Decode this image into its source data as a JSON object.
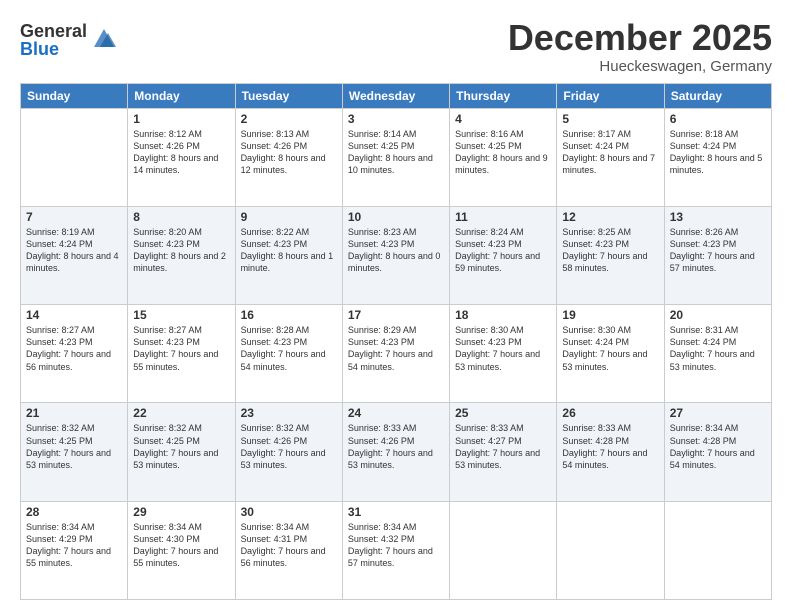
{
  "logo": {
    "general": "General",
    "blue": "Blue"
  },
  "title": "December 2025",
  "location": "Hueckeswagen, Germany",
  "days_of_week": [
    "Sunday",
    "Monday",
    "Tuesday",
    "Wednesday",
    "Thursday",
    "Friday",
    "Saturday"
  ],
  "weeks": [
    [
      {
        "num": "",
        "sunrise": "",
        "sunset": "",
        "daylight": ""
      },
      {
        "num": "1",
        "sunrise": "Sunrise: 8:12 AM",
        "sunset": "Sunset: 4:26 PM",
        "daylight": "Daylight: 8 hours and 14 minutes."
      },
      {
        "num": "2",
        "sunrise": "Sunrise: 8:13 AM",
        "sunset": "Sunset: 4:26 PM",
        "daylight": "Daylight: 8 hours and 12 minutes."
      },
      {
        "num": "3",
        "sunrise": "Sunrise: 8:14 AM",
        "sunset": "Sunset: 4:25 PM",
        "daylight": "Daylight: 8 hours and 10 minutes."
      },
      {
        "num": "4",
        "sunrise": "Sunrise: 8:16 AM",
        "sunset": "Sunset: 4:25 PM",
        "daylight": "Daylight: 8 hours and 9 minutes."
      },
      {
        "num": "5",
        "sunrise": "Sunrise: 8:17 AM",
        "sunset": "Sunset: 4:24 PM",
        "daylight": "Daylight: 8 hours and 7 minutes."
      },
      {
        "num": "6",
        "sunrise": "Sunrise: 8:18 AM",
        "sunset": "Sunset: 4:24 PM",
        "daylight": "Daylight: 8 hours and 5 minutes."
      }
    ],
    [
      {
        "num": "7",
        "sunrise": "Sunrise: 8:19 AM",
        "sunset": "Sunset: 4:24 PM",
        "daylight": "Daylight: 8 hours and 4 minutes."
      },
      {
        "num": "8",
        "sunrise": "Sunrise: 8:20 AM",
        "sunset": "Sunset: 4:23 PM",
        "daylight": "Daylight: 8 hours and 2 minutes."
      },
      {
        "num": "9",
        "sunrise": "Sunrise: 8:22 AM",
        "sunset": "Sunset: 4:23 PM",
        "daylight": "Daylight: 8 hours and 1 minute."
      },
      {
        "num": "10",
        "sunrise": "Sunrise: 8:23 AM",
        "sunset": "Sunset: 4:23 PM",
        "daylight": "Daylight: 8 hours and 0 minutes."
      },
      {
        "num": "11",
        "sunrise": "Sunrise: 8:24 AM",
        "sunset": "Sunset: 4:23 PM",
        "daylight": "Daylight: 7 hours and 59 minutes."
      },
      {
        "num": "12",
        "sunrise": "Sunrise: 8:25 AM",
        "sunset": "Sunset: 4:23 PM",
        "daylight": "Daylight: 7 hours and 58 minutes."
      },
      {
        "num": "13",
        "sunrise": "Sunrise: 8:26 AM",
        "sunset": "Sunset: 4:23 PM",
        "daylight": "Daylight: 7 hours and 57 minutes."
      }
    ],
    [
      {
        "num": "14",
        "sunrise": "Sunrise: 8:27 AM",
        "sunset": "Sunset: 4:23 PM",
        "daylight": "Daylight: 7 hours and 56 minutes."
      },
      {
        "num": "15",
        "sunrise": "Sunrise: 8:27 AM",
        "sunset": "Sunset: 4:23 PM",
        "daylight": "Daylight: 7 hours and 55 minutes."
      },
      {
        "num": "16",
        "sunrise": "Sunrise: 8:28 AM",
        "sunset": "Sunset: 4:23 PM",
        "daylight": "Daylight: 7 hours and 54 minutes."
      },
      {
        "num": "17",
        "sunrise": "Sunrise: 8:29 AM",
        "sunset": "Sunset: 4:23 PM",
        "daylight": "Daylight: 7 hours and 54 minutes."
      },
      {
        "num": "18",
        "sunrise": "Sunrise: 8:30 AM",
        "sunset": "Sunset: 4:23 PM",
        "daylight": "Daylight: 7 hours and 53 minutes."
      },
      {
        "num": "19",
        "sunrise": "Sunrise: 8:30 AM",
        "sunset": "Sunset: 4:24 PM",
        "daylight": "Daylight: 7 hours and 53 minutes."
      },
      {
        "num": "20",
        "sunrise": "Sunrise: 8:31 AM",
        "sunset": "Sunset: 4:24 PM",
        "daylight": "Daylight: 7 hours and 53 minutes."
      }
    ],
    [
      {
        "num": "21",
        "sunrise": "Sunrise: 8:32 AM",
        "sunset": "Sunset: 4:25 PM",
        "daylight": "Daylight: 7 hours and 53 minutes."
      },
      {
        "num": "22",
        "sunrise": "Sunrise: 8:32 AM",
        "sunset": "Sunset: 4:25 PM",
        "daylight": "Daylight: 7 hours and 53 minutes."
      },
      {
        "num": "23",
        "sunrise": "Sunrise: 8:32 AM",
        "sunset": "Sunset: 4:26 PM",
        "daylight": "Daylight: 7 hours and 53 minutes."
      },
      {
        "num": "24",
        "sunrise": "Sunrise: 8:33 AM",
        "sunset": "Sunset: 4:26 PM",
        "daylight": "Daylight: 7 hours and 53 minutes."
      },
      {
        "num": "25",
        "sunrise": "Sunrise: 8:33 AM",
        "sunset": "Sunset: 4:27 PM",
        "daylight": "Daylight: 7 hours and 53 minutes."
      },
      {
        "num": "26",
        "sunrise": "Sunrise: 8:33 AM",
        "sunset": "Sunset: 4:28 PM",
        "daylight": "Daylight: 7 hours and 54 minutes."
      },
      {
        "num": "27",
        "sunrise": "Sunrise: 8:34 AM",
        "sunset": "Sunset: 4:28 PM",
        "daylight": "Daylight: 7 hours and 54 minutes."
      }
    ],
    [
      {
        "num": "28",
        "sunrise": "Sunrise: 8:34 AM",
        "sunset": "Sunset: 4:29 PM",
        "daylight": "Daylight: 7 hours and 55 minutes."
      },
      {
        "num": "29",
        "sunrise": "Sunrise: 8:34 AM",
        "sunset": "Sunset: 4:30 PM",
        "daylight": "Daylight: 7 hours and 55 minutes."
      },
      {
        "num": "30",
        "sunrise": "Sunrise: 8:34 AM",
        "sunset": "Sunset: 4:31 PM",
        "daylight": "Daylight: 7 hours and 56 minutes."
      },
      {
        "num": "31",
        "sunrise": "Sunrise: 8:34 AM",
        "sunset": "Sunset: 4:32 PM",
        "daylight": "Daylight: 7 hours and 57 minutes."
      },
      {
        "num": "",
        "sunrise": "",
        "sunset": "",
        "daylight": ""
      },
      {
        "num": "",
        "sunrise": "",
        "sunset": "",
        "daylight": ""
      },
      {
        "num": "",
        "sunrise": "",
        "sunset": "",
        "daylight": ""
      }
    ]
  ]
}
